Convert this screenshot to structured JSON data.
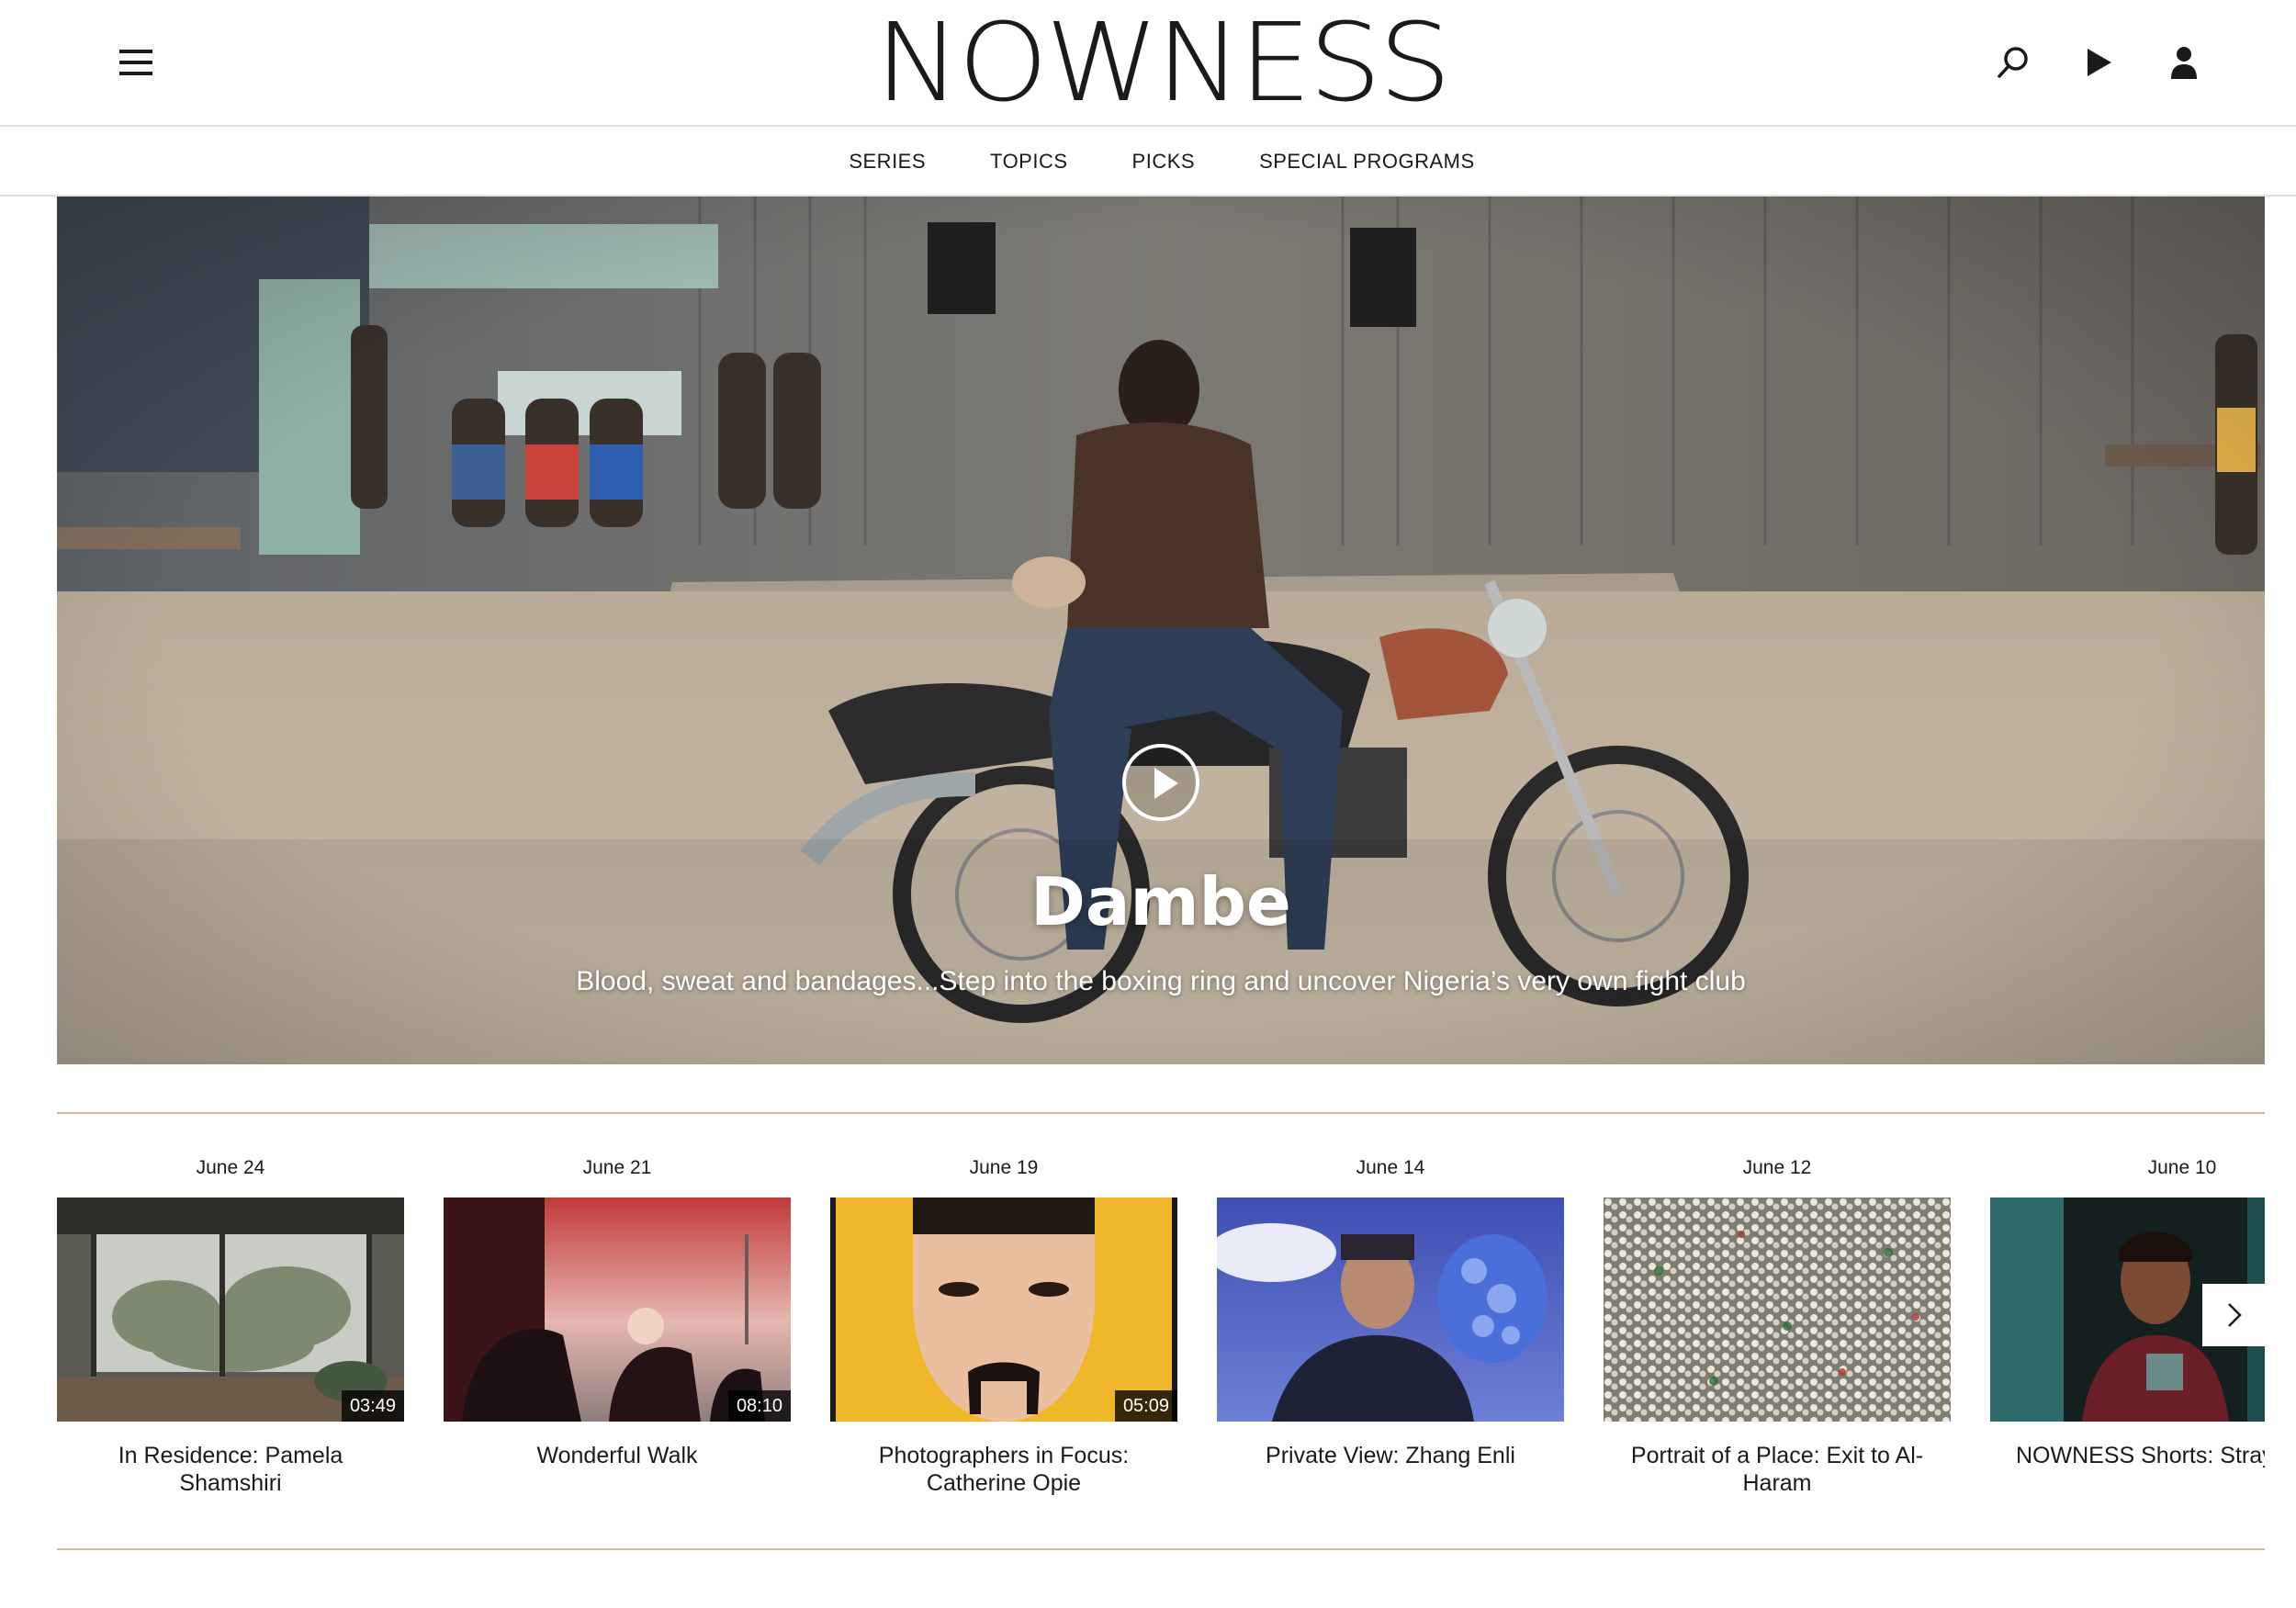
{
  "header": {
    "logo": "NOWNESS",
    "icons": [
      "menu-icon",
      "search-icon",
      "play-icon",
      "user-icon"
    ]
  },
  "nav": {
    "items": [
      "SERIES",
      "TOPICS",
      "PICKS",
      "SPECIAL PROGRAMS"
    ]
  },
  "hero": {
    "title": "Dambe",
    "subtitle": "Blood, sweat and bandages...Step into the boxing ring and uncover Nigeria’s very own fight club"
  },
  "rail": {
    "cards": [
      {
        "date": "June 24",
        "duration": "03:49",
        "title": "In Residence: Pamela Shamshiri"
      },
      {
        "date": "June 21",
        "duration": "08:10",
        "title": "Wonderful Walk"
      },
      {
        "date": "June 19",
        "duration": "05:09",
        "title": "Photographers in Focus: Catherine Opie"
      },
      {
        "date": "June 14",
        "duration": "",
        "title": "Private View: Zhang Enli"
      },
      {
        "date": "June 12",
        "duration": "",
        "title": "Portrait of a Place: Exit to Al-Haram"
      },
      {
        "date": "June 10",
        "duration": "",
        "title": "NOWNESS Shorts: Stray S"
      }
    ]
  },
  "colors": {
    "text": "#1a1a1a",
    "divider": "#cdb9a0",
    "border": "#e1e1e1"
  }
}
